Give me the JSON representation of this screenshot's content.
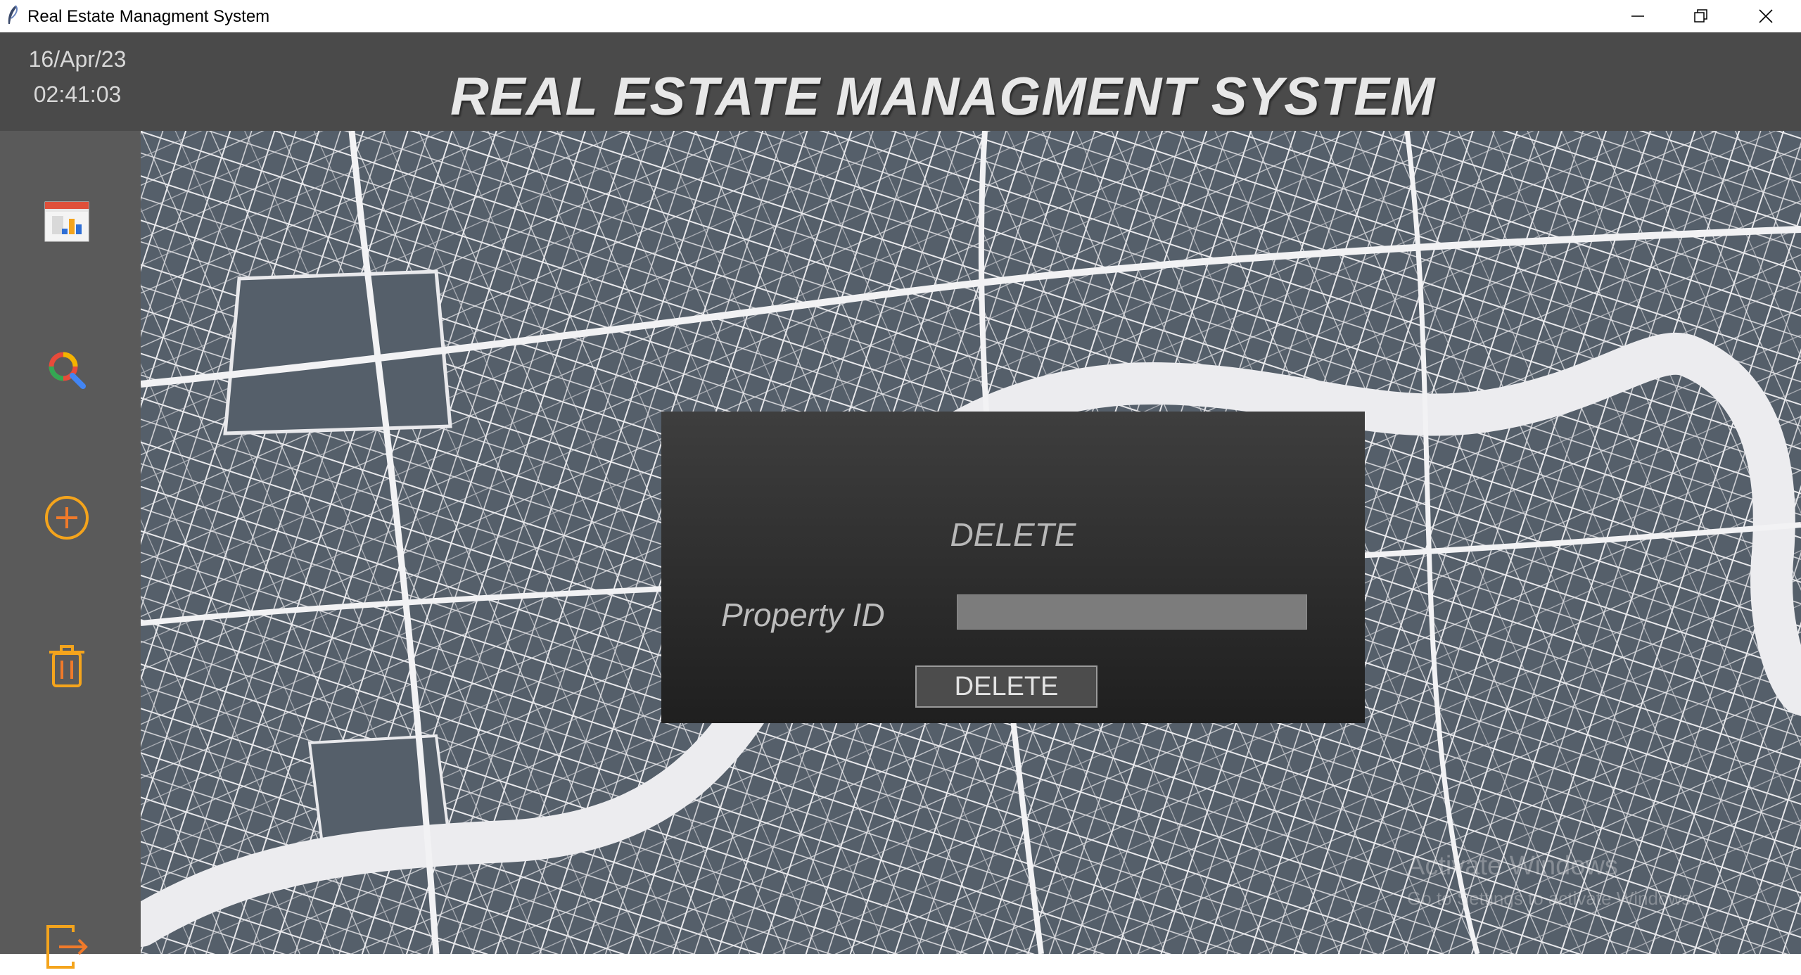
{
  "window": {
    "title": "Real Estate Managment System"
  },
  "header": {
    "date": "16/Apr/23",
    "time": "02:41:03",
    "title": "REAL ESTATE MANAGMENT SYSTEM"
  },
  "sidebar": {
    "items": [
      {
        "name": "report",
        "icon": "chart-report-icon"
      },
      {
        "name": "search",
        "icon": "search-icon"
      },
      {
        "name": "add",
        "icon": "plus-circle-icon"
      },
      {
        "name": "delete",
        "icon": "trash-icon"
      },
      {
        "name": "logout",
        "icon": "logout-icon"
      }
    ]
  },
  "dialog": {
    "heading": "DELETE",
    "property_id_label": "Property ID",
    "property_id_value": "",
    "delete_button": "DELETE"
  },
  "watermark": {
    "line1": "Activate Windows",
    "line2": "Go to Settings to activate Windows."
  },
  "colors": {
    "header_bg": "#4a4a4a",
    "sidebar_bg": "#5a5a5a",
    "map_bg": "#555f6a",
    "dialog_bg": "#2e2e2e",
    "accent_orange": "#f4a41c"
  }
}
